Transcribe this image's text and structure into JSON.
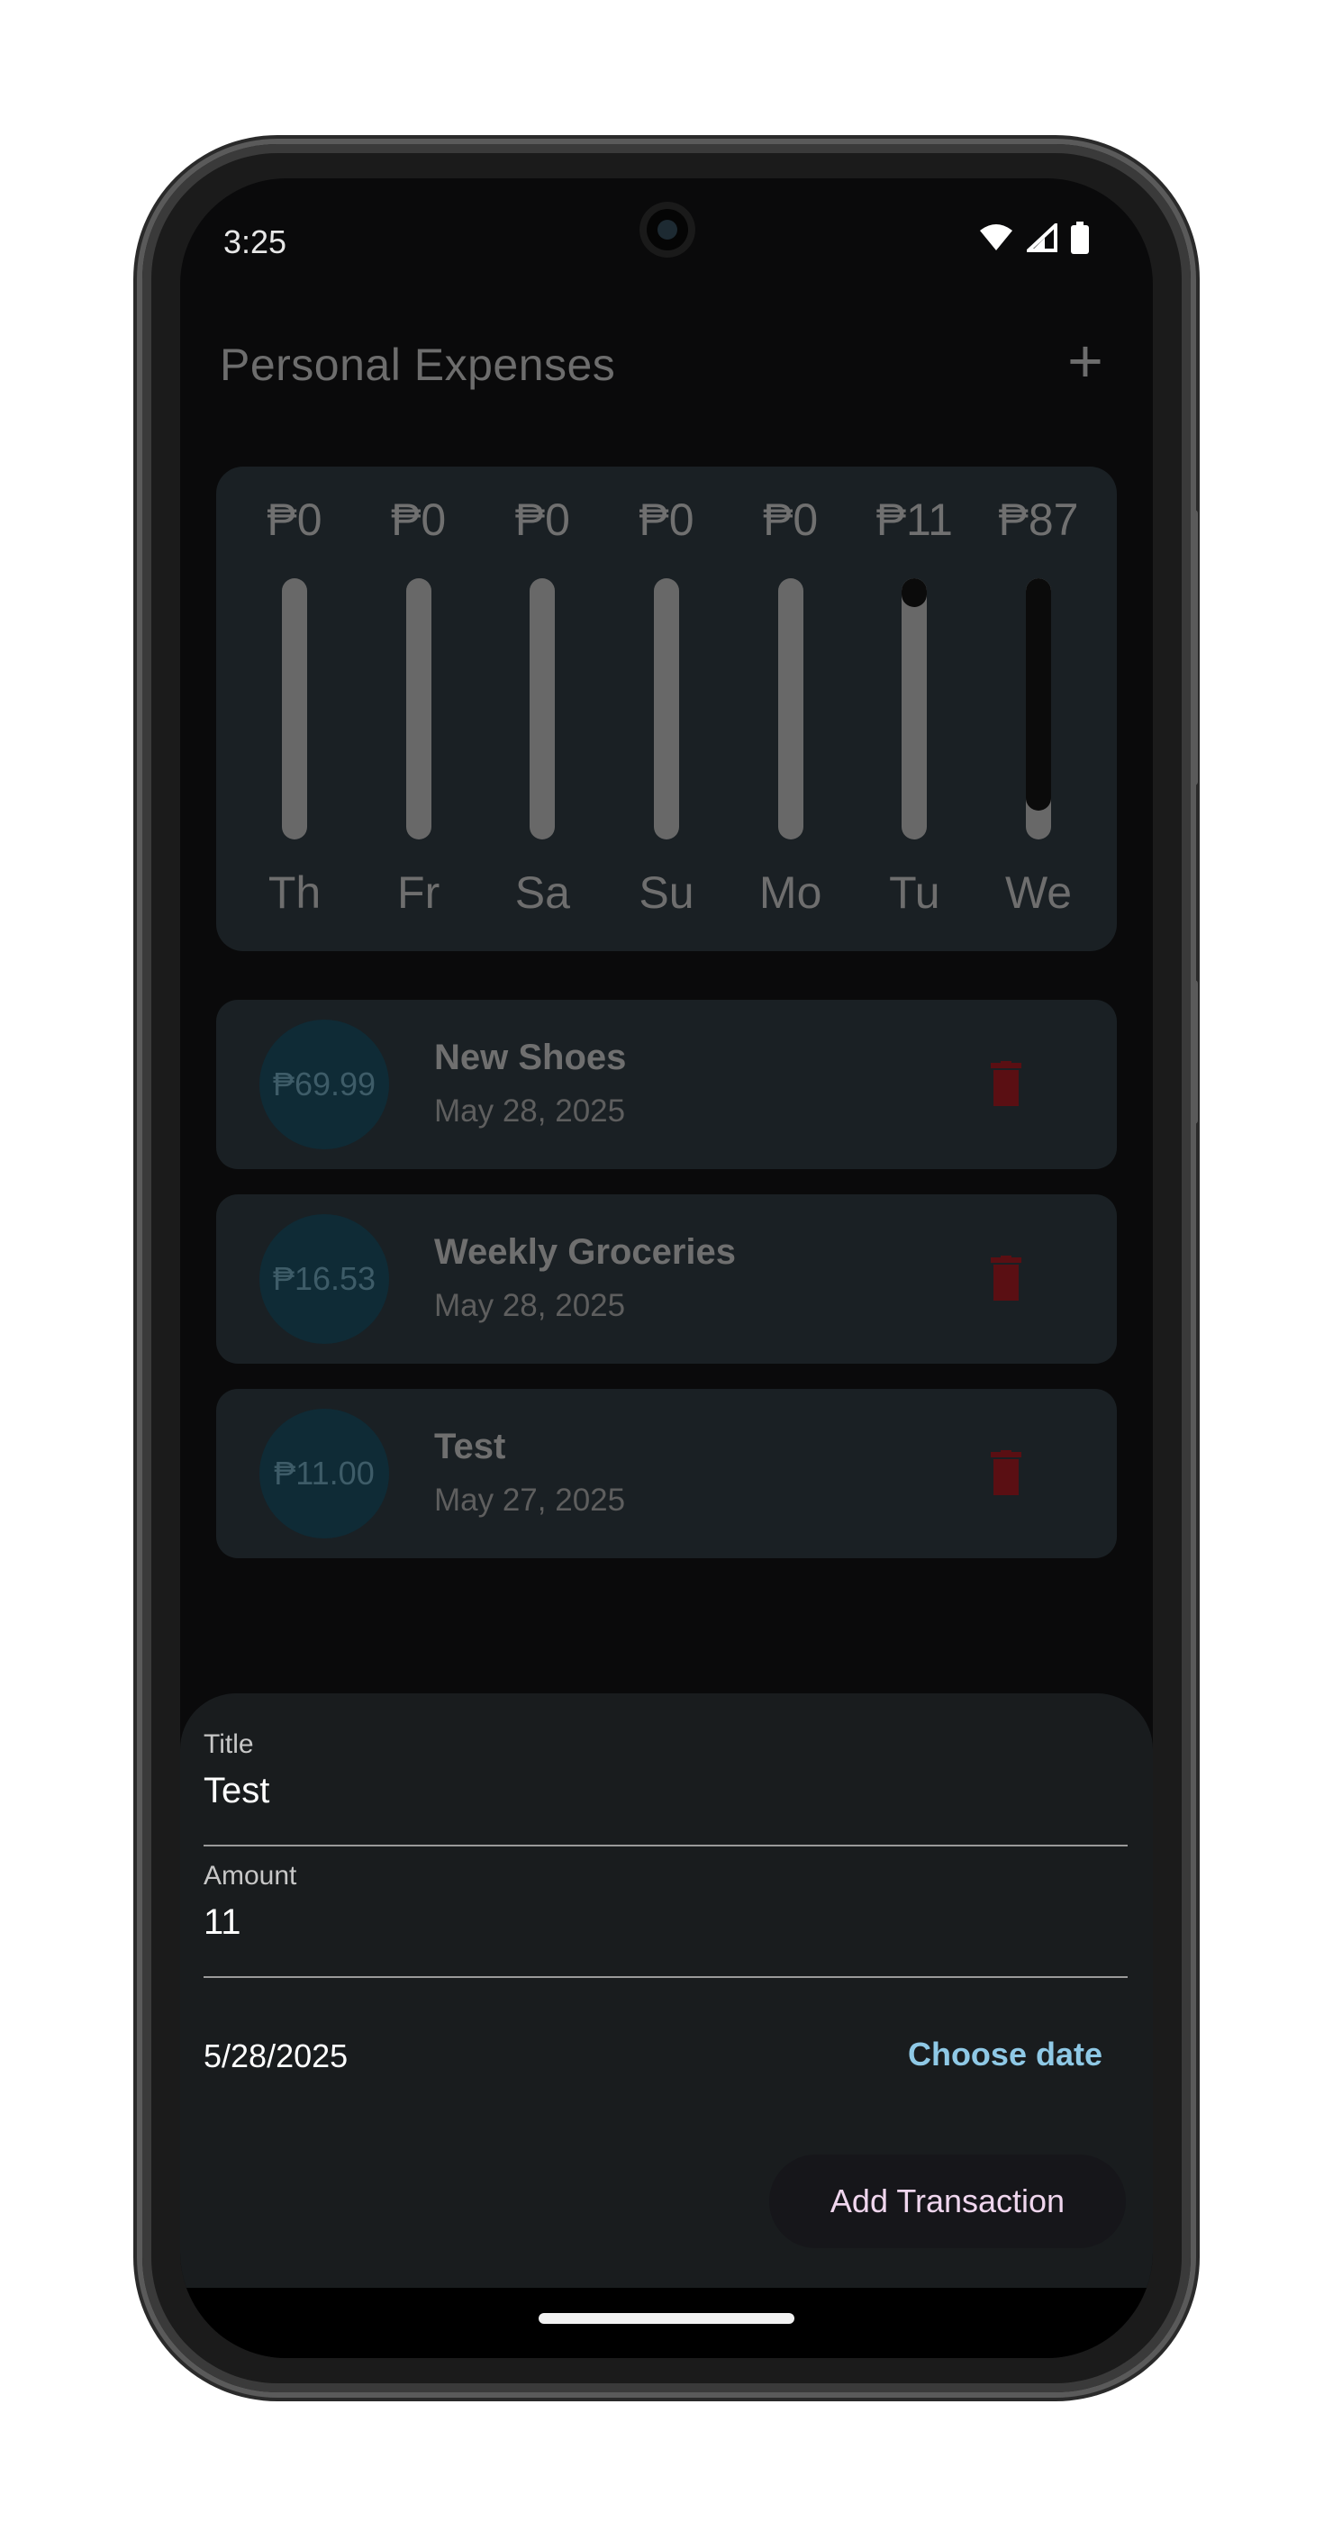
{
  "status_bar": {
    "time": "3:25"
  },
  "app_bar": {
    "title": "Personal Expenses",
    "add_icon": "plus-icon"
  },
  "chart_data": {
    "type": "bar",
    "categories": [
      "Th",
      "Fr",
      "Sa",
      "Su",
      "Mo",
      "Tu",
      "We"
    ],
    "labels": [
      "₱0",
      "₱0",
      "₱0",
      "₱0",
      "₱0",
      "₱11",
      "₱87"
    ],
    "values": [
      0,
      0,
      0,
      0,
      0,
      11,
      87
    ],
    "fill_fraction": [
      0,
      0,
      0,
      0,
      0,
      0.11,
      0.89
    ]
  },
  "transactions": [
    {
      "amount": "₱69.99",
      "title": "New Shoes",
      "date": "May 28, 2025",
      "delete_icon": "trash-icon"
    },
    {
      "amount": "₱16.53",
      "title": "Weekly Groceries",
      "date": "May 28, 2025",
      "delete_icon": "trash-icon"
    },
    {
      "amount": "₱11.00",
      "title": "Test",
      "date": "May 27, 2025",
      "delete_icon": "trash-icon"
    }
  ],
  "form": {
    "title_label": "Title",
    "title_value": "Test",
    "amount_label": "Amount",
    "amount_value": "11",
    "date_value": "5/28/2025",
    "choose_date_label": "Choose date",
    "submit_label": "Add Transaction"
  },
  "colors": {
    "screen_bg": "#0a0a0b",
    "card_bg": "#1a2024",
    "accent_text": "#8fc9e6",
    "delete_icon": "#5a0f13"
  }
}
